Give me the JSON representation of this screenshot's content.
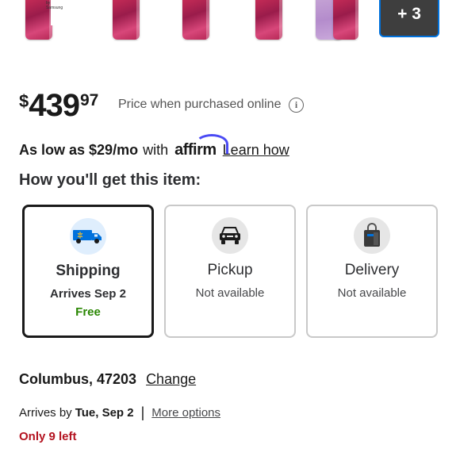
{
  "thumbnails": {
    "box_text": "by Samsung",
    "more_count": "+ 3"
  },
  "price": {
    "currency": "$",
    "whole": "439",
    "cents": "97",
    "note": "Price when purchased online",
    "info_icon": "info-icon"
  },
  "affirm": {
    "prefix": "As low as $29/mo",
    "with": "with",
    "logo": "affirm",
    "learn_how": "Learn how"
  },
  "fulfillment": {
    "title": "How you'll get this item:",
    "options": [
      {
        "label": "Shipping",
        "status": "Arrives Sep 2",
        "extra": "Free",
        "icon": "truck-icon",
        "selected": true
      },
      {
        "label": "Pickup",
        "status": "Not available",
        "icon": "car-icon",
        "selected": false
      },
      {
        "label": "Delivery",
        "status": "Not available",
        "icon": "bag-icon",
        "selected": false
      }
    ]
  },
  "location": {
    "text": "Columbus, 47203",
    "change": "Change"
  },
  "arrival": {
    "prefix": "Arrives by",
    "date": "Tue, Sep 2",
    "separator": "|",
    "more_options": "More options"
  },
  "stock": {
    "text": "Only 9 left"
  },
  "colors": {
    "accent": "#0071dc",
    "free": "#2a8703",
    "stock": "#b3121f",
    "affirm": "#4a4af4"
  }
}
